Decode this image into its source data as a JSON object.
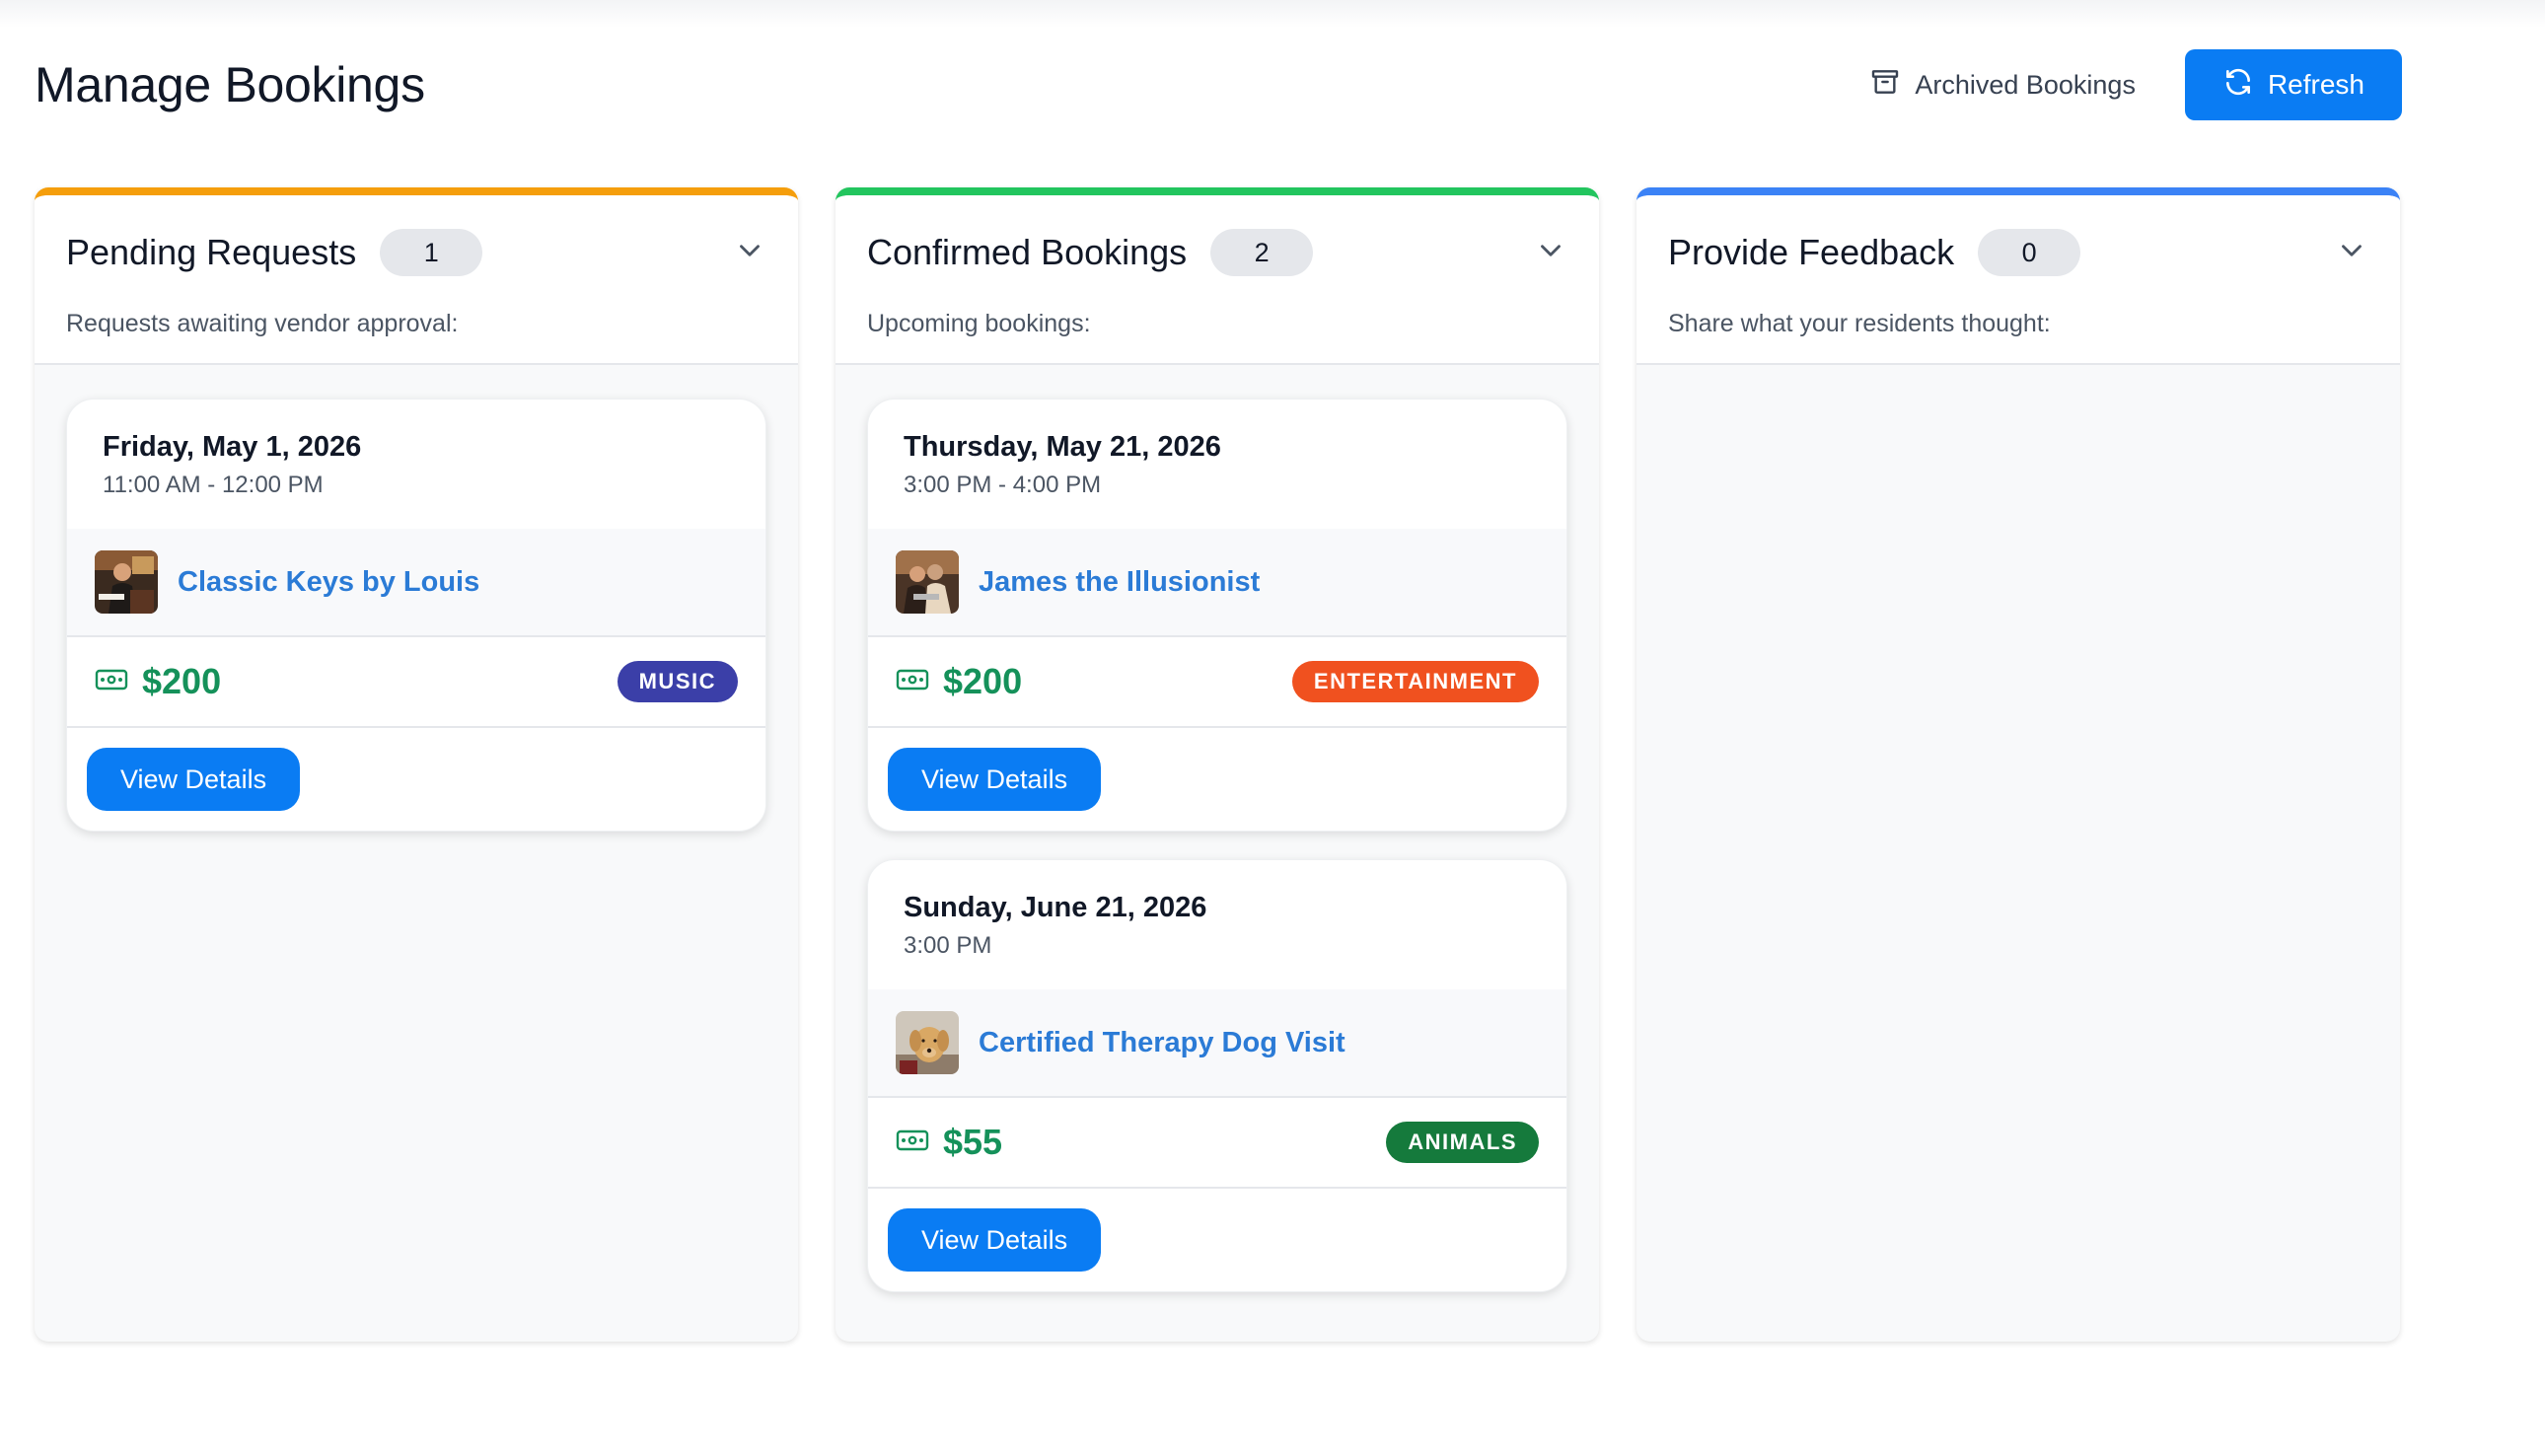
{
  "header": {
    "title": "Manage Bookings",
    "archived_label": "Archived Bookings",
    "refresh_label": "Refresh"
  },
  "colors": {
    "primary": "#0a7cf3",
    "pending_accent": "#f59e0b",
    "confirmed_accent": "#22c55e",
    "feedback_accent": "#3b82f6",
    "price_green": "#15915a",
    "vendor_link": "#2b7bd6"
  },
  "columns": [
    {
      "title": "Pending Requests",
      "count": "1",
      "subtitle": "Requests awaiting vendor approval:",
      "bookings": [
        {
          "date": "Friday, May 1, 2026",
          "time": "11:00 AM - 12:00 PM",
          "vendor": "Classic Keys by Louis",
          "vendor_icon": "pianist-photo",
          "price": "$200",
          "category": "MUSIC",
          "category_color": "#3b3fa8",
          "action": "View Details"
        }
      ]
    },
    {
      "title": "Confirmed Bookings",
      "count": "2",
      "subtitle": "Upcoming bookings:",
      "bookings": [
        {
          "date": "Thursday, May 21, 2026",
          "time": "3:00 PM - 4:00 PM",
          "vendor": "James the Illusionist",
          "vendor_icon": "magician-photo",
          "price": "$200",
          "category": "ENTERTAINMENT",
          "category_color": "#f0511f",
          "action": "View Details"
        },
        {
          "date": "Sunday, June 21, 2026",
          "time": "3:00 PM",
          "vendor": "Certified Therapy Dog Visit",
          "vendor_icon": "dog-photo",
          "price": "$55",
          "category": "ANIMALS",
          "category_color": "#157a3c",
          "action": "View Details"
        }
      ]
    },
    {
      "title": "Provide Feedback",
      "count": "0",
      "subtitle": "Share what your residents thought:",
      "bookings": []
    }
  ]
}
